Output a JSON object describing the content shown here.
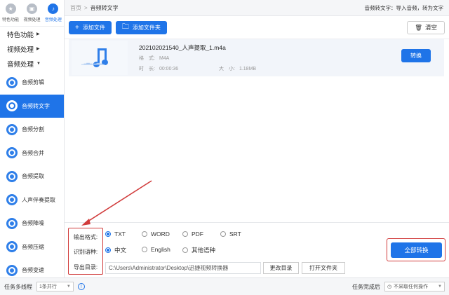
{
  "sidebar": {
    "top_tabs": [
      {
        "label": "特色功能",
        "icon": "star-icon"
      },
      {
        "label": "视频处理",
        "icon": "video-icon"
      },
      {
        "label": "音频处理",
        "icon": "audio-icon",
        "active": true
      }
    ],
    "categories": [
      {
        "label": "特色功能",
        "arrow": "▶"
      },
      {
        "label": "视频处理",
        "arrow": "▶"
      },
      {
        "label": "音频处理",
        "arrow": "▼"
      }
    ],
    "items": [
      {
        "label": "音频剪辑"
      },
      {
        "label": "音频转文字",
        "active": true
      },
      {
        "label": "音频分割"
      },
      {
        "label": "音频合并"
      },
      {
        "label": "音频提取"
      },
      {
        "label": "人声伴奏提取"
      },
      {
        "label": "音频降噪"
      },
      {
        "label": "音频压缩"
      },
      {
        "label": "音频变速"
      }
    ]
  },
  "header": {
    "breadcrumb_home": "首页",
    "breadcrumb_sep": ">",
    "breadcrumb_current": "音频转文字",
    "info": "音频转文字：导入音频，转为文字"
  },
  "toolbar": {
    "add_file": "添加文件",
    "add_folder": "添加文件夹",
    "clear": "清空"
  },
  "file": {
    "name": "202102021540_人声提取_1.m4a",
    "format_label": "格　式:",
    "format_value": "M4A",
    "duration_label": "时　长:",
    "duration_value": "00:00:36",
    "size_label": "大　小:",
    "size_value": "1.18MB",
    "convert_label": "转换"
  },
  "settings": {
    "output_format_label": "输出格式:",
    "formats": [
      "TXT",
      "WORD",
      "PDF",
      "SRT"
    ],
    "selected_format": "TXT",
    "language_label": "识别语种:",
    "languages": [
      "中文",
      "English",
      "其他语种"
    ],
    "selected_language": "中文",
    "output_dir_label": "导出目录:",
    "output_dir_value": "C:\\Users\\Administrator\\Desktop\\迅捷视频转换器",
    "change_dir": "更改目录",
    "open_folder": "打开文件夹",
    "convert_all": "全部转换"
  },
  "statusbar": {
    "multithread_label": "任务多线程",
    "thread_value": "1条并行",
    "after_done_label": "任务完成后",
    "after_done_value": "不采取任何操作"
  },
  "colors": {
    "accent": "#1f74e8",
    "annotation": "#d13b3b"
  }
}
